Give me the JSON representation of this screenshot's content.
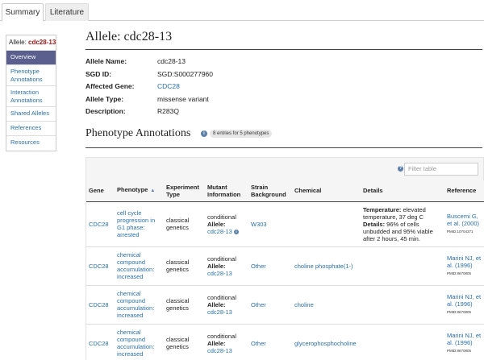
{
  "tabs": [
    {
      "label": "Summary",
      "active": true
    },
    {
      "label": "Literature",
      "active": false
    }
  ],
  "sidebar": {
    "title_prefix": "Allele: ",
    "title_name": "cdc28-13",
    "items": [
      {
        "label": "Overview",
        "active": true
      },
      {
        "label": "Phenotype Annotations"
      },
      {
        "label": "Interaction Annotations"
      },
      {
        "label": "Shared Alleles"
      },
      {
        "label": "References"
      },
      {
        "label": "Resources"
      }
    ]
  },
  "page_title": "Allele: cdc28-13",
  "info": {
    "name_label": "Allele Name:",
    "name_value": "cdc28-13",
    "sgdid_label": "SGD ID:",
    "sgdid_value": "SGD:S000277960",
    "gene_label": "Affected Gene:",
    "gene_value": "CDC28",
    "type_label": "Allele Type:",
    "type_value": "missense variant",
    "desc_label": "Description:",
    "desc_value": "R283Q"
  },
  "phenotype": {
    "title": "Phenotype Annotations",
    "info_glyph": "i",
    "badge": "8 entries for 5 phenotypes",
    "help_glyph": "?",
    "filter_placeholder": "Filter table",
    "sort_glyph": "▲",
    "columns": {
      "gene": "Gene",
      "phenotype": "Phenotype",
      "experiment": "Experiment Type",
      "mutant": "Mutant Information",
      "strain": "Strain Background",
      "chemical": "Chemical",
      "details": "Details",
      "reference": "Reference"
    },
    "allele_label": "Allele:",
    "rows": [
      {
        "gene": "CDC28",
        "phenotype": "cell cycle progression in G1 phase: arrested",
        "experiment": "classical genetics",
        "mutant_type": "conditional",
        "allele": "cdc28-13",
        "strain": "W303",
        "chemical": "",
        "details_temp_label": "Temperature:",
        "details_temp_value": " elevated temperature, 37 deg C",
        "details_label": "Details:",
        "details_value": " 96% of cells unbudded and 95% viable after 2 hours, 45 min.",
        "reference": "Buscemi G, et al. (2000)",
        "pmid": "PMID:10704371"
      },
      {
        "gene": "CDC28",
        "phenotype": "chemical compound accumulation: increased",
        "experiment": "classical genetics",
        "mutant_type": "conditional",
        "allele": "cdc28-13",
        "strain": "Other",
        "chemical": "choline phosphate(1-)",
        "reference": "Marini NJ, et al. (1996)",
        "pmid": "PMID:8670805"
      },
      {
        "gene": "CDC28",
        "phenotype": "chemical compound accumulation: increased",
        "experiment": "classical genetics",
        "mutant_type": "conditional",
        "allele": "cdc28-13",
        "strain": "Other",
        "chemical": "choline",
        "reference": "Marini NJ, et al. (1996)",
        "pmid": "PMID:8670805"
      },
      {
        "gene": "CDC28",
        "phenotype": "chemical compound accumulation: increased",
        "experiment": "classical genetics",
        "mutant_type": "conditional",
        "allele": "cdc28-13",
        "strain": "Other",
        "chemical": "glycerophosphocholine",
        "reference": "Marini NJ, et al. (1996)",
        "pmid": "PMID:8670805"
      }
    ]
  },
  "colors": {
    "link": "#2a6fa8",
    "sidebar_active": "#5b5f8d",
    "allele_name": "#a01818"
  }
}
